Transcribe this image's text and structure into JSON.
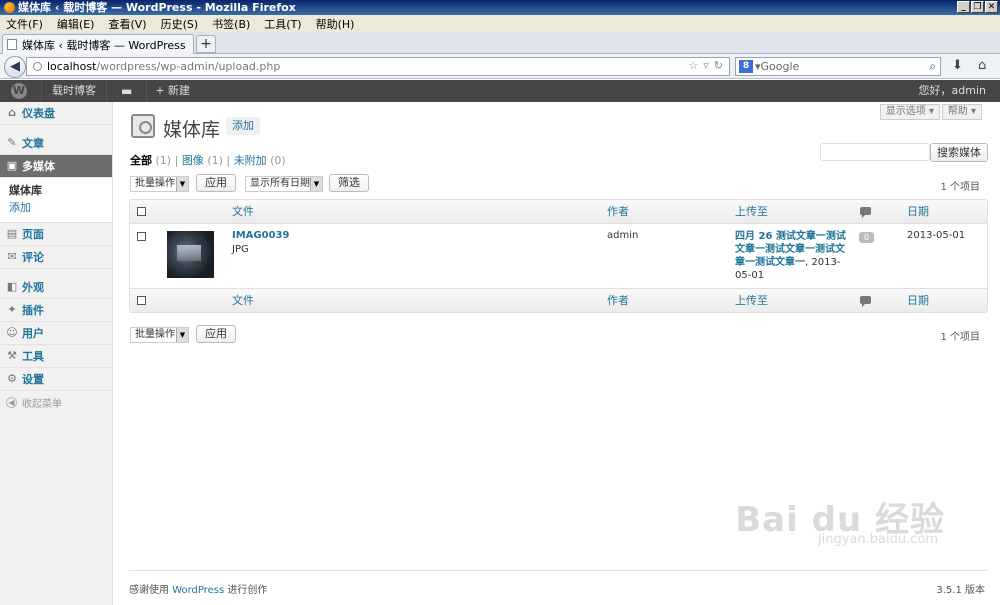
{
  "browser": {
    "window_title": "媒体库 ‹ 载时博客 — WordPress - Mozilla Firefox",
    "window_buttons": [
      "_",
      "❐",
      "✕"
    ],
    "menu": [
      "文件(F)",
      "编辑(E)",
      "查看(V)",
      "历史(S)",
      "书签(B)",
      "工具(T)",
      "帮助(H)"
    ],
    "tab_title": "媒体库 ‹ 载时博客 — WordPress",
    "newtab_label": "+",
    "url_host": "localhost",
    "url_path": "/wordpress/wp-admin/upload.php",
    "search_engine_letter": "8",
    "search_placeholder": "Google"
  },
  "adminbar": {
    "logo": "W",
    "site_name": "载时博客",
    "new_label": "+ 新建",
    "howdy": "您好，admin"
  },
  "sidebar": {
    "items": [
      {
        "label": "仪表盘",
        "icon": "⌂"
      },
      {
        "label": "文章",
        "icon": "✎"
      },
      {
        "label": "多媒体",
        "icon": "▣"
      },
      {
        "label": "页面",
        "icon": "▤"
      },
      {
        "label": "评论",
        "icon": "✉"
      },
      {
        "label": "外观",
        "icon": "◧"
      },
      {
        "label": "插件",
        "icon": "✦"
      },
      {
        "label": "用户",
        "icon": "☺"
      },
      {
        "label": "工具",
        "icon": "⚒"
      },
      {
        "label": "设置",
        "icon": "⚙"
      }
    ],
    "submenu": {
      "current": "媒体库",
      "add": "添加"
    },
    "collapse": "收起菜单"
  },
  "main": {
    "screen_options": "显示选项 ▾",
    "help": "帮助 ▾",
    "title": "媒体库",
    "add_new": "添加",
    "filters": {
      "all": "全部",
      "all_count": "(1)",
      "image": "图像",
      "image_count": "(1)",
      "unattached": "未附加",
      "unattached_count": "(0)",
      "sep": "|"
    },
    "search_button": "搜索媒体",
    "bulk_actions": "批量操作",
    "apply": "应用",
    "date_filter": "显示所有日期",
    "filter_button": "筛选",
    "item_count": "1 个项目",
    "columns": {
      "file": "文件",
      "author": "作者",
      "uploaded_to": "上传至",
      "date": "日期"
    },
    "rows": [
      {
        "file": "IMAG0039",
        "type": "JPG",
        "author": "admin",
        "attached_post": "四月 26 测试文章一测试文章一测试文章一测试文章一测试文章一",
        "attached_date": ", 2013-05-01",
        "comments": "0",
        "date": "2013-05-01"
      }
    ]
  },
  "footer": {
    "thanks_prefix": "感谢使用 ",
    "wp_link": "WordPress",
    "thanks_suffix": " 进行创作",
    "version": "3.5.1 版本"
  },
  "watermark": {
    "main": "Bai du 经验",
    "sub": "jingyan.baidu.com"
  }
}
